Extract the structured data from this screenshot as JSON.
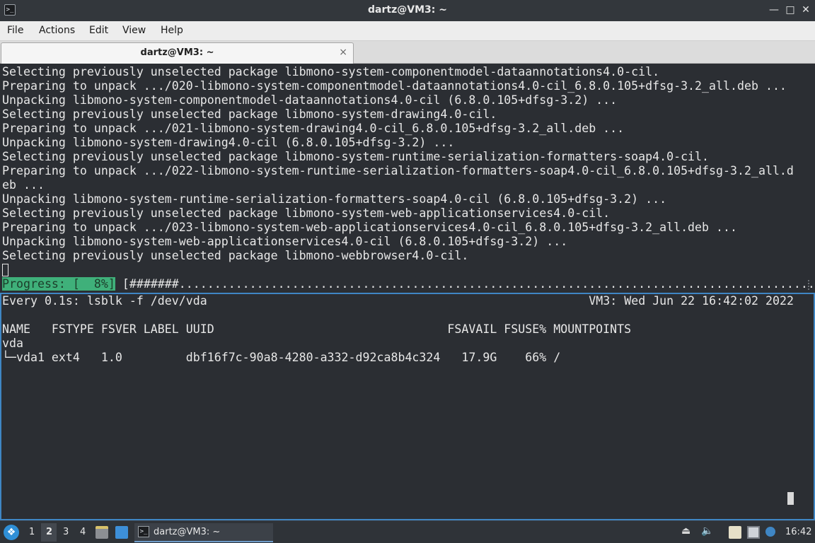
{
  "window": {
    "title": "dartz@VM3: ~",
    "icon": "terminal-icon",
    "controls": {
      "minimize": "—",
      "restore": "□",
      "close": "✕"
    }
  },
  "menu": {
    "items": [
      "File",
      "Actions",
      "Edit",
      "View",
      "Help"
    ]
  },
  "tabs": [
    {
      "label": "dartz@VM3: ~",
      "close": "×"
    }
  ],
  "top_pane": {
    "lines": [
      "Selecting previously unselected package libmono-system-componentmodel-dataannotations4.0-cil.",
      "Preparing to unpack .../020-libmono-system-componentmodel-dataannotations4.0-cil_6.8.0.105+dfsg-3.2_all.deb ...",
      "Unpacking libmono-system-componentmodel-dataannotations4.0-cil (6.8.0.105+dfsg-3.2) ...",
      "Selecting previously unselected package libmono-system-drawing4.0-cil.",
      "Preparing to unpack .../021-libmono-system-drawing4.0-cil_6.8.0.105+dfsg-3.2_all.deb ...",
      "Unpacking libmono-system-drawing4.0-cil (6.8.0.105+dfsg-3.2) ...",
      "Selecting previously unselected package libmono-system-runtime-serialization-formatters-soap4.0-cil.",
      "Preparing to unpack .../022-libmono-system-runtime-serialization-formatters-soap4.0-cil_6.8.0.105+dfsg-3.2_all.d",
      "eb ...",
      "Unpacking libmono-system-runtime-serialization-formatters-soap4.0-cil (6.8.0.105+dfsg-3.2) ...",
      "Selecting previously unselected package libmono-system-web-applicationservices4.0-cil.",
      "Preparing to unpack .../023-libmono-system-web-applicationservices4.0-cil_6.8.0.105+dfsg-3.2_all.deb ...",
      "Unpacking libmono-system-web-applicationservices4.0-cil (6.8.0.105+dfsg-3.2) ...",
      "Selecting previously unselected package libmono-webbrowser4.0-cil."
    ],
    "progress_label": "Progress: [  8%]",
    "progress_bar": " [#######..........................................................................................]",
    "progress_percent": 8
  },
  "bottom_pane": {
    "watch_left": "Every 0.1s: lsblk -f /dev/vda",
    "watch_right": "VM3: Wed Jun 22 16:42:02 2022",
    "header": "NAME   FSTYPE FSVER LABEL UUID                                 FSAVAIL FSUSE% MOUNTPOINTS",
    "rows": [
      "vda",
      "└─vda1 ext4   1.0         dbf16f7c-90a8-4280-a332-d92ca8b4c324   17.9G    66% /"
    ]
  },
  "taskbar": {
    "start_icon": "start-menu-icon",
    "workspaces": [
      "1",
      "2",
      "3",
      "4"
    ],
    "active_workspace": "2",
    "launchers": [
      "file-manager-icon",
      "show-desktop-icon"
    ],
    "task_label": "dartz@VM3: ~",
    "tray": [
      "eject-icon",
      "volume-icon",
      "clipboard-icon",
      "network-icon",
      "notification-icon"
    ],
    "clock": "16:42"
  },
  "colors": {
    "terminal_bg": "#2b2e33",
    "terminal_fg": "#e7e7e7",
    "progress_bg": "#3fb07a",
    "active_pane_border": "#3f86c4"
  }
}
